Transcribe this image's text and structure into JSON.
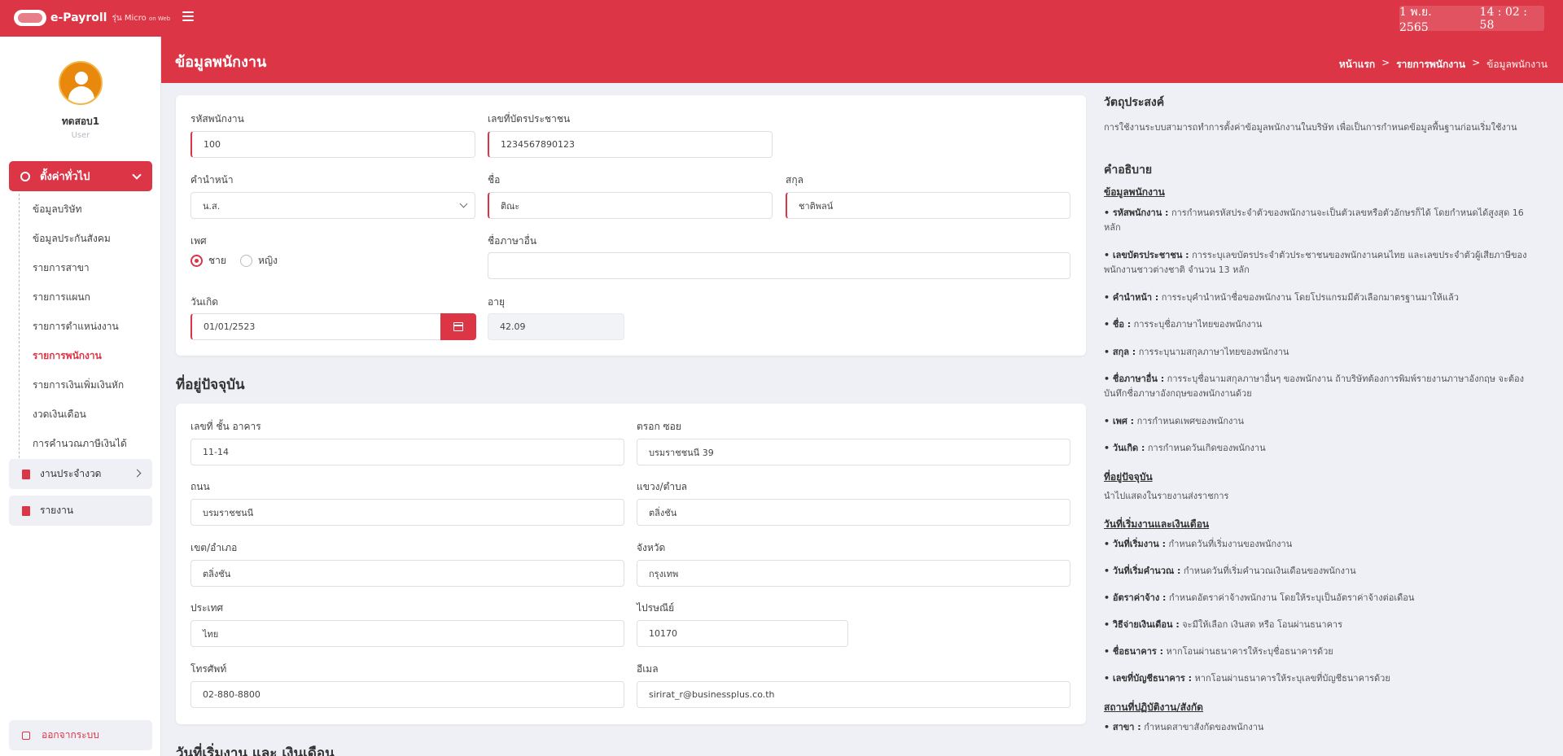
{
  "topbar": {
    "brand_name": "e-Payroll",
    "brand_sub": "รุ่น Micro",
    "brand_sub_small": "on Web",
    "date": "1 พ.ย. 2565",
    "time": "14 : 02 : 58",
    "accent_color": "#dc3545"
  },
  "user": {
    "name": "ทดสอบ1",
    "role": "User"
  },
  "sidebar": {
    "main_label": "ตั้งค่าทั่วไป",
    "sub_items": [
      {
        "label": "ข้อมูลบริษัท"
      },
      {
        "label": "ข้อมูลประกันสังคม"
      },
      {
        "label": "รายการสาขา"
      },
      {
        "label": "รายการแผนก"
      },
      {
        "label": "รายการตำแหน่งงาน"
      },
      {
        "label": "รายการพนักงาน"
      },
      {
        "label": "รายการเงินเพิ่มเงินหัก"
      },
      {
        "label": "งวดเงินเดือน"
      },
      {
        "label": "การคำนวณภาษีเงินได้"
      }
    ],
    "period_work_label": "งานประจำงวด",
    "report_label": "รายงาน",
    "logout_label": "ออกจากระบบ"
  },
  "header": {
    "title": "ข้อมูลพนักงาน",
    "breadcrumb": {
      "home": "หน้าแรก",
      "employees": "รายการพนักงาน",
      "current": "ข้อมูลพนักงาน",
      "separator": ">"
    }
  },
  "employee_form": {
    "employee_code": {
      "label": "รหัสพนักงาน",
      "value": "100"
    },
    "national_id": {
      "label": "เลขที่บัตรประชาชน",
      "value": "1234567890123"
    },
    "prefix": {
      "label": "คำนำหน้า",
      "value": "น.ส."
    },
    "first_name": {
      "label": "ชื่อ",
      "value": "ติณะ"
    },
    "last_name": {
      "label": "สกุล",
      "value": "ชาติพลน์"
    },
    "gender": {
      "label": "เพศ",
      "male": "ชาย",
      "female": "หญิง"
    },
    "other_language_name": {
      "label": "ชื่อภาษาอื่น",
      "value": ""
    },
    "birth_date": {
      "label": "วันเกิด",
      "value": "01/01/2523"
    },
    "age": {
      "label": "อายุ",
      "value": "42.09"
    }
  },
  "address_section": {
    "title": "ที่อยู่ปัจจุบัน",
    "house_no": {
      "label": "เลขที่ ชั้น อาคาร",
      "value": "11-14"
    },
    "alley": {
      "label": "ตรอก ซอย",
      "value": "บรมราชชนนี 39"
    },
    "road": {
      "label": "ถนน",
      "value": "บรมราชชนนี"
    },
    "subdistrict": {
      "label": "แขวง/ตำบล",
      "value": "ตลิ่งชัน"
    },
    "district": {
      "label": "เขต/อำเภอ",
      "value": "ตลิ่งชัน"
    },
    "province": {
      "label": "จังหวัด",
      "value": "กรุงเทพ"
    },
    "country": {
      "label": "ประเทศ",
      "value": "ไทย"
    },
    "postal_code": {
      "label": "ไปรษณีย์",
      "value": "10170"
    },
    "phone": {
      "label": "โทรศัพท์",
      "value": "02-880-8800"
    },
    "email": {
      "label": "อีเมล",
      "value": "sirirat_r@businessplus.co.th"
    }
  },
  "next_section_title": "วันที่เริ่มงาน และ เงินเดือน",
  "help": {
    "purpose_title": "วัตถุประสงค์",
    "purpose_text": "การใช้งานระบบสามารถทำการตั้งค่าข้อมูลพนักงานในบริษัท เพื่อเป็นการกำหนดข้อมูลพื้นฐานก่อนเริ่มใช้งาน",
    "desc_title": "คำอธิบาย",
    "employee_info_title": "ข้อมูลพนักงาน",
    "items_a": [
      {
        "term": "• รหัสพนักงาน :",
        "text": "การกำหนดรหัสประจำตัวของพนักงานจะเป็นตัวเลขหรือตัวอักษรก็ได้ โดยกำหนดได้สูงสุด 16 หลัก"
      },
      {
        "term": "• เลขบัตรประชาชน :",
        "text": "การระบุเลขบัตรประจำตัวประชาชนของพนักงานคนไทย และเลขประจำตัวผู้เสียภาษีของพนักงานชาวต่างชาติ จำนวน 13 หลัก"
      },
      {
        "term": "• คำนำหน้า :",
        "text": "การระบุคำนำหน้าชื่อของพนักงาน โดยโปรแกรมมีตัวเลือกมาตรฐานมาให้แล้ว"
      },
      {
        "term": "• ชื่อ :",
        "text": "การระบุชื่อภาษาไทยของพนักงาน"
      },
      {
        "term": "• สกุล :",
        "text": "การระบุนามสกุลภาษาไทยของพนักงาน"
      },
      {
        "term": "• ชื่อภาษาอื่น :",
        "text": "การระบุชื่อนามสกุลภาษาอื่นๆ ของพนักงาน ถ้าบริษัทต้องการพิมพ์รายงานภาษาอังกฤษ จะต้องบันทึกชื่อภาษาอังกฤษของพนักงานด้วย"
      },
      {
        "term": "• เพศ :",
        "text": "การกำหนดเพศของพนักงาน"
      },
      {
        "term": "• วันเกิด :",
        "text": "การกำหนดวันเกิดของพนักงาน"
      }
    ],
    "address_title": "ที่อยู่ปัจจุบัน",
    "address_text": "นำไปแสดงในรายงานส่งราชการ",
    "start_title": "วันที่เริ่มงานและเงินเดือน",
    "items_b": [
      {
        "term": "• วันที่เริ่มงาน :",
        "text": "กำหนดวันที่เริ่มงานของพนักงาน"
      },
      {
        "term": "• วันที่เริ่มคำนวณ :",
        "text": "กำหนดวันที่เริ่มคำนวณเงินเดือนของพนักงาน"
      },
      {
        "term": "• อัตราค่าจ้าง :",
        "text": "กำหนดอัตราค่าจ้างพนักงาน โดยให้ระบุเป็นอัตราค่าจ้างต่อเดือน"
      },
      {
        "term": "• วิธีจ่ายเงินเดือน :",
        "text": "จะมีให้เลือก เงินสด หรือ โอนผ่านธนาคาร"
      },
      {
        "term": "• ชื่อธนาคาร :",
        "text": "หากโอนผ่านธนาคารให้ระบุชื่อธนาคารด้วย"
      },
      {
        "term": "• เลขที่บัญชีธนาคาร :",
        "text": "หากโอนผ่านธนาคารให้ระบุเลขที่บัญชีธนาคารด้วย"
      }
    ],
    "workplace_title": "สถานที่ปฏิบัติงาน/สังกัด",
    "items_c": [
      {
        "term": "• สาขา :",
        "text": "กำหนดสาขาสังกัดของพนักงาน"
      }
    ]
  }
}
